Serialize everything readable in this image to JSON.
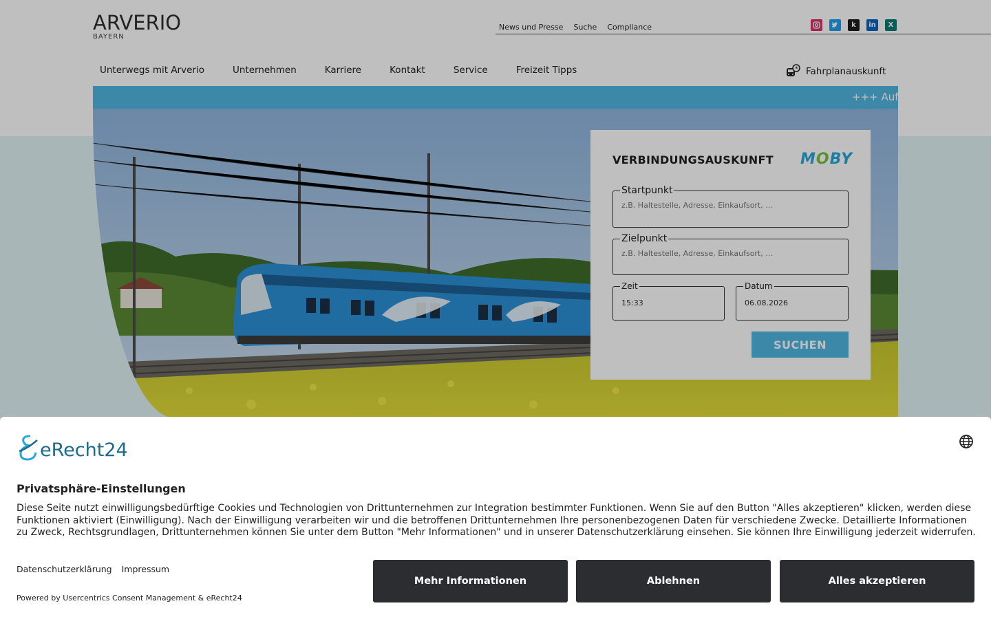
{
  "header": {
    "logo_text": "ARVERIO",
    "logo_sub": "BAYERN",
    "utility_links": [
      "News und Presse",
      "Suche",
      "Compliance"
    ],
    "social_icons": [
      "instagram-icon",
      "twitter-icon",
      "kununu-icon",
      "linkedin-icon",
      "xing-icon"
    ]
  },
  "nav": {
    "items": [
      "Unterwegs mit Arverio",
      "Unternehmen",
      "Karriere",
      "Kontakt",
      "Service",
      "Freizeit Tipps"
    ],
    "timetable_label": "Fahrplanauskunft"
  },
  "ticker": {
    "text": "+++ Aufg"
  },
  "search": {
    "title": "VERBINDUNGSAUSKUNFT",
    "partner_logo": "MOBY",
    "start_label": "Startpunkt",
    "start_placeholder": "z.B. Haltestelle, Adresse, Einkaufsort, ...",
    "ziel_label": "Zielpunkt",
    "ziel_placeholder": "z.B. Haltestelle, Adresse, Einkaufsort, ...",
    "zeit_label": "Zeit",
    "zeit_value": "15:33",
    "datum_label": "Datum",
    "datum_value": "06.08.2026",
    "submit_label": "SUCHEN"
  },
  "consent": {
    "brand": "eRecht24",
    "title": "Privatsphäre-Einstellungen",
    "text": "Diese Seite nutzt einwilligungsbedürftige Cookies und Technologien von Drittunternehmen zur Integration bestimmter Funktionen. Wenn Sie auf den Button \"Alles akzeptieren\" klicken, werden diese Funktionen aktiviert (Einwilligung). Nach der Einwilligung verarbeiten wir und die betroffenen Drittunternehmen Ihre personenbezogenen Daten für verschiedene Zwecke. Detaillierte Informationen zu Zweck, Rechtsgrundlagen, Drittunternehmen können Sie unter dem Button \"Mehr Informationen\" und in unserer Datenschutzerklärung einsehen. Sie können Ihre Einwilligung jederzeit widerrufen.",
    "link_privacy": "Datenschutzerklärung",
    "link_imprint": "Impressum",
    "powered": "Powered by Usercentrics Consent Management & eRecht24",
    "btn_more": "Mehr Informationen",
    "btn_decline": "Ablehnen",
    "btn_accept": "Alles akzeptieren"
  },
  "colors": {
    "accent": "#4fb6e0",
    "consent_button": "#2b2d31",
    "brand_teal": "#1d6b8a"
  }
}
